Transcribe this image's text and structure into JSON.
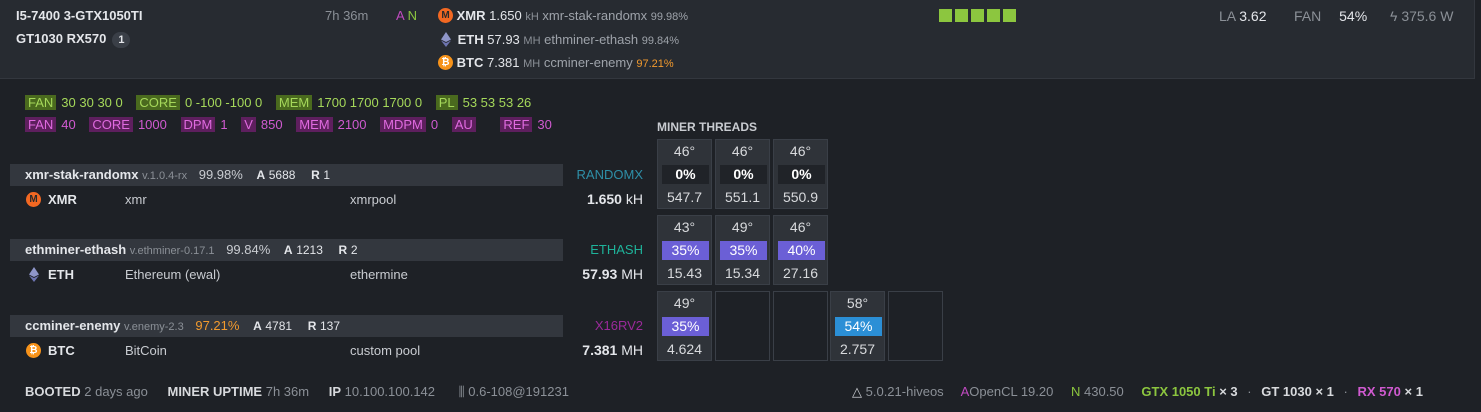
{
  "header": {
    "rig_line1": "I5-7400 3-GTX1050TI",
    "rig_line2": "GT1030 RX570",
    "rig_count": "1",
    "uptime": "7h 36m",
    "flag_a": "A",
    "flag_n": "N",
    "coins": [
      {
        "ticker": "XMR",
        "value": "1.650",
        "unit": "kH",
        "miner": "xmr-stak-randomx",
        "pct": "99.98%"
      },
      {
        "ticker": "ETH",
        "value": "57.93",
        "unit": "MH",
        "miner": "ethminer-ethash",
        "pct": "99.84%"
      },
      {
        "ticker": "BTC",
        "value": "7.381",
        "unit": "MH",
        "miner": "ccminer-enemy",
        "pct": "97.21%"
      }
    ],
    "la_label": "LA",
    "la_value": "3.62",
    "fan_label": "FAN",
    "fan_value": "54%",
    "power": "375.6 W"
  },
  "oc": {
    "nvidia": [
      {
        "tag": "FAN",
        "val": "30 30 30 0"
      },
      {
        "tag": "CORE",
        "val": "0 -100 -100 0"
      },
      {
        "tag": "MEM",
        "val": "1700 1700 1700 0"
      },
      {
        "tag": "PL",
        "val": "53 53 53 26"
      }
    ],
    "amd": [
      {
        "tag": "FAN",
        "val": "40"
      },
      {
        "tag": "CORE",
        "val": "1000"
      },
      {
        "tag": "DPM",
        "val": "1"
      },
      {
        "tag": "V",
        "val": "850"
      },
      {
        "tag": "MEM",
        "val": "2100"
      },
      {
        "tag": "MDPM",
        "val": "0"
      },
      {
        "tag": "AU",
        "val": ""
      },
      {
        "tag": "REF",
        "val": "30"
      }
    ]
  },
  "miners": [
    {
      "name": "xmr-stak-randomx",
      "version": "v.1.0.4-rx",
      "pct": "99.98%",
      "a_label": "A",
      "a": "5688",
      "r_label": "R",
      "r": "1",
      "algo": "RANDOMX",
      "algo_color": "#2e8fa8",
      "ticker": "XMR",
      "wallet": "xmr",
      "pool": "xmrpool",
      "hashrate": "1.650",
      "unit": "kH"
    },
    {
      "name": "ethminer-ethash",
      "version": "v.ethminer-0.17.1",
      "pct": "99.84%",
      "a_label": "A",
      "a": "1213",
      "r_label": "R",
      "r": "2",
      "algo": "ETHASH",
      "algo_color": "#1eb39a",
      "ticker": "ETH",
      "wallet": "Ethereum (ewal)",
      "pool": "ethermine",
      "hashrate": "57.93",
      "unit": "MH"
    },
    {
      "name": "ccminer-enemy",
      "version": "v.enemy-2.3",
      "pct": "97.21%",
      "a_label": "A",
      "a": "4781",
      "r_label": "R",
      "r": "137",
      "algo": "X16RV2",
      "algo_color": "#9a2a9a",
      "ticker": "BTC",
      "wallet": "BitCoin",
      "pool": "custom pool",
      "hashrate": "7.381",
      "unit": "MH"
    }
  ],
  "threads": {
    "title": "MINER THREADS",
    "rows": [
      [
        {
          "temp": "46°",
          "load": "0%",
          "hash": "547.7",
          "color": "#202328"
        },
        {
          "temp": "46°",
          "load": "0%",
          "hash": "551.1",
          "color": "#202328"
        },
        {
          "temp": "46°",
          "load": "0%",
          "hash": "550.9",
          "color": "#202328"
        }
      ],
      [
        {
          "temp": "43°",
          "load": "35%",
          "hash": "15.43",
          "color": "#6b5fd6"
        },
        {
          "temp": "49°",
          "load": "35%",
          "hash": "15.34",
          "color": "#6b5fd6"
        },
        {
          "temp": "46°",
          "load": "40%",
          "hash": "27.16",
          "color": "#6b5fd6"
        }
      ],
      [
        {
          "temp": "49°",
          "load": "35%",
          "hash": "4.624",
          "color": "#6b5fd6"
        },
        {
          "temp": "",
          "load": "",
          "hash": "",
          "color": ""
        },
        {
          "temp": "",
          "load": "",
          "hash": "",
          "color": ""
        },
        {
          "temp": "58°",
          "load": "54%",
          "hash": "2.757",
          "color": "#2b8fd6"
        },
        {
          "temp": "",
          "load": "",
          "hash": "",
          "color": ""
        }
      ]
    ]
  },
  "footer": {
    "booted_label": "BOOTED",
    "booted_value": "2 days ago",
    "uptime_label": "MINER UPTIME",
    "uptime_value": "7h 36m",
    "ip_label": "IP",
    "ip_value": "10.100.100.142",
    "version": "0.6-108@191231",
    "kernel": "5.0.21-hiveos",
    "amd_prefix": "A",
    "amd_driver": "OpenCL 19.20",
    "nv_prefix": "N",
    "nv_driver": "430.50",
    "gpu1": "GTX 1050 Ti",
    "gpu1_count": "× 3",
    "gpu2": "GT 1030",
    "gpu2_count": "× 1",
    "gpu3": "RX 570",
    "gpu3_count": "× 1",
    "sep": "·"
  }
}
